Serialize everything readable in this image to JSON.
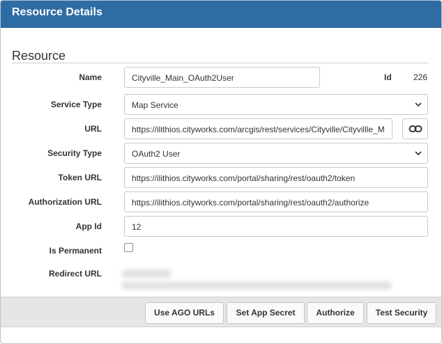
{
  "dialog": {
    "title": "Resource Details",
    "section_title": "Resource"
  },
  "fields": {
    "name": {
      "label": "Name",
      "value": "Cityville_Main_OAuth2User"
    },
    "id": {
      "label": "Id",
      "value": "226"
    },
    "service_type": {
      "label": "Service Type",
      "value": "Map Service"
    },
    "url": {
      "label": "URL",
      "value": "https://ilithios.cityworks.com/arcgis/rest/services/Cityville/Cityvillle_M"
    },
    "security_type": {
      "label": "Security Type",
      "value": "OAuth2 User"
    },
    "token_url": {
      "label": "Token URL",
      "value": "https://ilithios.cityworks.com/portal/sharing/rest/oauth2/token"
    },
    "authorization_url": {
      "label": "Authorization URL",
      "value": "https://ilithios.cityworks.com/portal/sharing/rest/oauth2/authorize"
    },
    "app_id": {
      "label": "App Id",
      "value": "12"
    },
    "is_permanent": {
      "label": "Is Permanent",
      "checked": false
    },
    "redirect_url": {
      "label": "Redirect URL"
    }
  },
  "icons": {
    "url_link": "link-icon",
    "select_chevron": "chevron-down-icon"
  },
  "buttons": {
    "use_ago_urls": "Use AGO URLs",
    "set_app_secret": "Set App Secret",
    "authorize": "Authorize",
    "test_security": "Test Security"
  },
  "colors": {
    "header_bg": "#2e6da4",
    "footer_bg": "#e6e6e6"
  }
}
